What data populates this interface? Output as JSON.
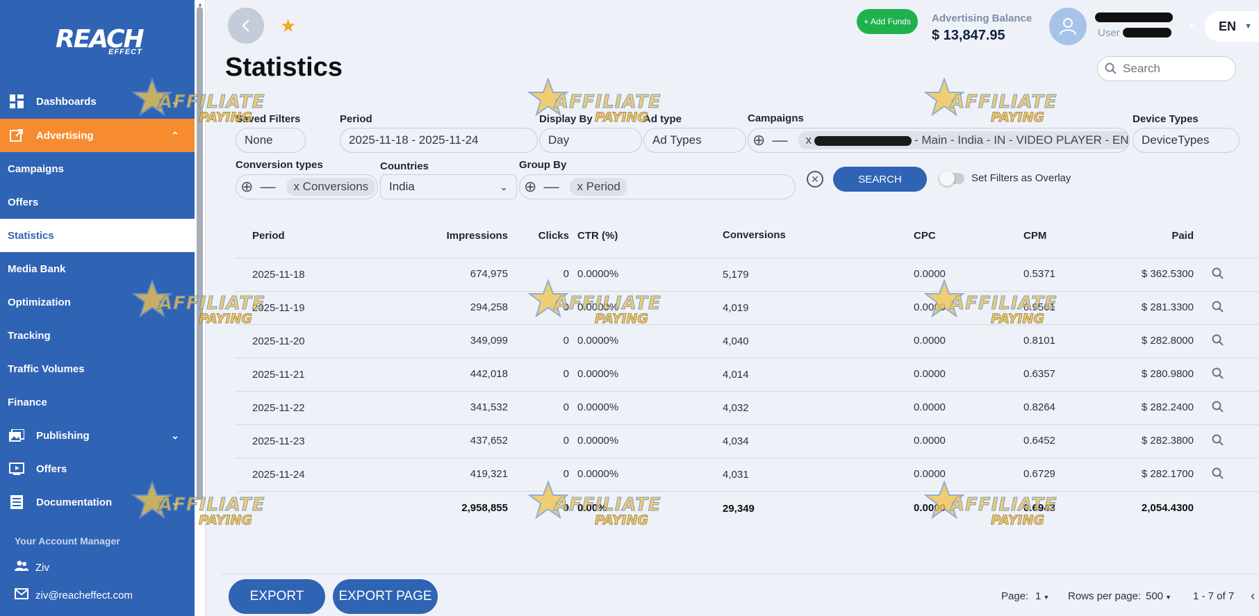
{
  "brand": {
    "logo_main": "REACH",
    "logo_sub": "EFFECT"
  },
  "sidebar": {
    "items": [
      {
        "label": "Dashboards",
        "icon": "dashboard-icon",
        "has_chevron": true
      },
      {
        "label": "Advertising",
        "icon": "external-link-icon",
        "has_chevron": true,
        "state": "expanded"
      },
      {
        "label": "Campaigns"
      },
      {
        "label": "Offers"
      },
      {
        "label": "Statistics",
        "state": "active"
      },
      {
        "label": "Media Bank"
      },
      {
        "label": "Optimization"
      },
      {
        "label": "Tracking"
      },
      {
        "label": "Traffic Volumes"
      },
      {
        "label": "Finance"
      },
      {
        "label": "Publishing",
        "icon": "images-icon",
        "has_chevron": true
      },
      {
        "label": "Offers",
        "icon": "play-screen-icon"
      },
      {
        "label": "Documentation",
        "icon": "document-icon",
        "has_chevron": true
      }
    ],
    "account_manager": {
      "title": "Your Account Manager",
      "name": "Ziv",
      "email": "ziv@reacheffect.com"
    }
  },
  "header": {
    "add_funds": "+ Add Funds",
    "balance_label": "Advertising Balance",
    "balance_value": "$ 13,847.95",
    "user_label": "User",
    "language": "EN",
    "page_title": "Statistics",
    "search_placeholder": "Search"
  },
  "filters": {
    "saved_filters": {
      "label": "Saved Filters",
      "value": "None"
    },
    "period": {
      "label": "Period",
      "value": "2025-11-18 - 2025-11-24"
    },
    "display_by": {
      "label": "Display By",
      "value": "Day"
    },
    "ad_type": {
      "label": "Ad type",
      "value": "Ad Types"
    },
    "campaigns": {
      "label": "Campaigns",
      "chip_prefix": "x",
      "chip_text": "- Main - India - IN - VIDEO PLAYER - EN"
    },
    "device_types": {
      "label": "Device Types",
      "value": "DeviceTypes"
    },
    "conversion_types": {
      "label": "Conversion types",
      "chip": "x Conversions"
    },
    "countries": {
      "label": "Countries",
      "value": "India"
    },
    "group_by": {
      "label": "Group By",
      "chip": "x Period"
    },
    "search_button": "SEARCH",
    "overlay_toggle": {
      "label": "Set Filters as Overlay",
      "on": false
    }
  },
  "table": {
    "columns": [
      "Period",
      "Impressions",
      "Clicks",
      "CTR (%)",
      "Conversions",
      "CPC",
      "CPM",
      "Paid"
    ],
    "rows": [
      [
        "2025-11-18",
        "674,975",
        "0",
        "0.0000%",
        "5,179",
        "0.0000",
        "0.5371",
        "$ 362.5300"
      ],
      [
        "2025-11-19",
        "294,258",
        "0",
        "0.0000%",
        "4,019",
        "0.0000",
        "0.9561",
        "$ 281.3300"
      ],
      [
        "2025-11-20",
        "349,099",
        "0",
        "0.0000%",
        "4,040",
        "0.0000",
        "0.8101",
        "$ 282.8000"
      ],
      [
        "2025-11-21",
        "442,018",
        "0",
        "0.0000%",
        "4,014",
        "0.0000",
        "0.6357",
        "$ 280.9800"
      ],
      [
        "2025-11-22",
        "341,532",
        "0",
        "0.0000%",
        "4,032",
        "0.0000",
        "0.8264",
        "$ 282.2400"
      ],
      [
        "2025-11-23",
        "437,652",
        "0",
        "0.0000%",
        "4,034",
        "0.0000",
        "0.6452",
        "$ 282.3800"
      ],
      [
        "2025-11-24",
        "419,321",
        "0",
        "0.0000%",
        "4,031",
        "0.0000",
        "0.6729",
        "$ 282.1700"
      ]
    ],
    "totals": [
      "",
      "2,958,855",
      "0",
      "0.00%",
      "29,349",
      "0.0000",
      "0.6943",
      "2,054.4300"
    ]
  },
  "footer": {
    "export": "EXPORT",
    "export_page": "EXPORT PAGE",
    "page_label": "Page:",
    "page_value": "1",
    "rows_label": "Rows per page:",
    "rows_value": "500",
    "range": "1 - 7 of 7"
  },
  "watermark": {
    "top": "AFFILIATE",
    "bottom": "PAYING"
  },
  "colors": {
    "sidebar": "#2f63b4",
    "active_orange": "#f68b2f",
    "add_funds": "#1fb14e",
    "star": "#f5a623"
  }
}
